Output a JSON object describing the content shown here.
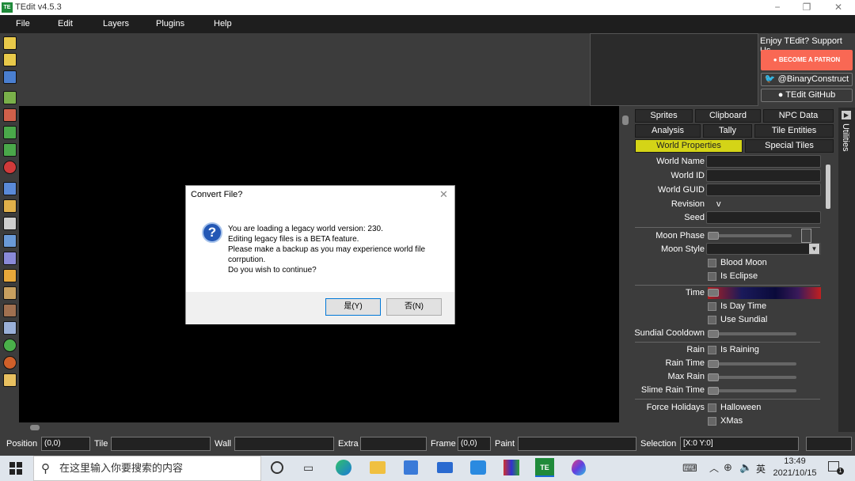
{
  "window": {
    "title": "TEdit v4.5.3",
    "icon_text": "TE",
    "controls": {
      "minimize": "−",
      "maximize": "❐",
      "close": "✕"
    }
  },
  "menu": [
    "File",
    "Edit",
    "Layers",
    "Plugins",
    "Help"
  ],
  "sponsor": {
    "label": "Enjoy TEdit? Support Us",
    "patron": "BECOME A PATRON",
    "twitter": "@BinaryConstruct",
    "github": "TEdit GitHub",
    "patron_color": "#f96854"
  },
  "tabs": {
    "row1": [
      "Sprites",
      "Clipboard",
      "NPC Data"
    ],
    "row2": [
      "Analysis",
      "Tally",
      "Tile Entities"
    ],
    "row3": [
      "World Properties",
      "Special Tiles"
    ],
    "active": "World Properties",
    "active_color": "#d4d417"
  },
  "utilities_label": "Utilities",
  "props": {
    "world_name": "World Name",
    "world_id": "World ID",
    "world_guid": "World GUID",
    "revision": "Revision",
    "revision_value": "v",
    "seed": "Seed",
    "moon_phase": "Moon Phase",
    "moon_style": "Moon Style",
    "blood_moon": "Blood Moon",
    "is_eclipse": "Is Eclipse",
    "time": "Time",
    "is_day_time": "Is Day Time",
    "use_sundial": "Use Sundial",
    "sundial_cooldown": "Sundial Cooldown",
    "rain": "Rain",
    "is_raining": "Is Raining",
    "rain_time": "Rain Time",
    "max_rain": "Max Rain",
    "slime_rain_time": "Slime Rain Time",
    "force_holidays": "Force Holidays",
    "halloween": "Halloween",
    "xmas": "XMas"
  },
  "status": {
    "position_label": "Position",
    "position_value": "(0,0)",
    "tile_label": "Tile",
    "wall_label": "Wall",
    "extra_label": "Extra",
    "frame_label": "Frame",
    "frame_value": "(0,0)",
    "paint_label": "Paint",
    "selection_label": "Selection",
    "selection_value": "[X:0 Y:0]"
  },
  "dialog": {
    "title": "Convert File?",
    "icon": "?",
    "close": "✕",
    "line1": "You are loading a legacy world version: 230.",
    "line2": "Editing legacy files is a BETA feature.",
    "line3": "Please make a backup as you may experience world file corrpution.",
    "line4": "Do you wish to continue?",
    "yes": "是(Y)",
    "no": "否(N)"
  },
  "taskbar": {
    "search_placeholder": "在这里输入你要搜索的内容",
    "time": "13:49",
    "date": "2021/10/15",
    "ime": "英",
    "notification_count": "1"
  }
}
